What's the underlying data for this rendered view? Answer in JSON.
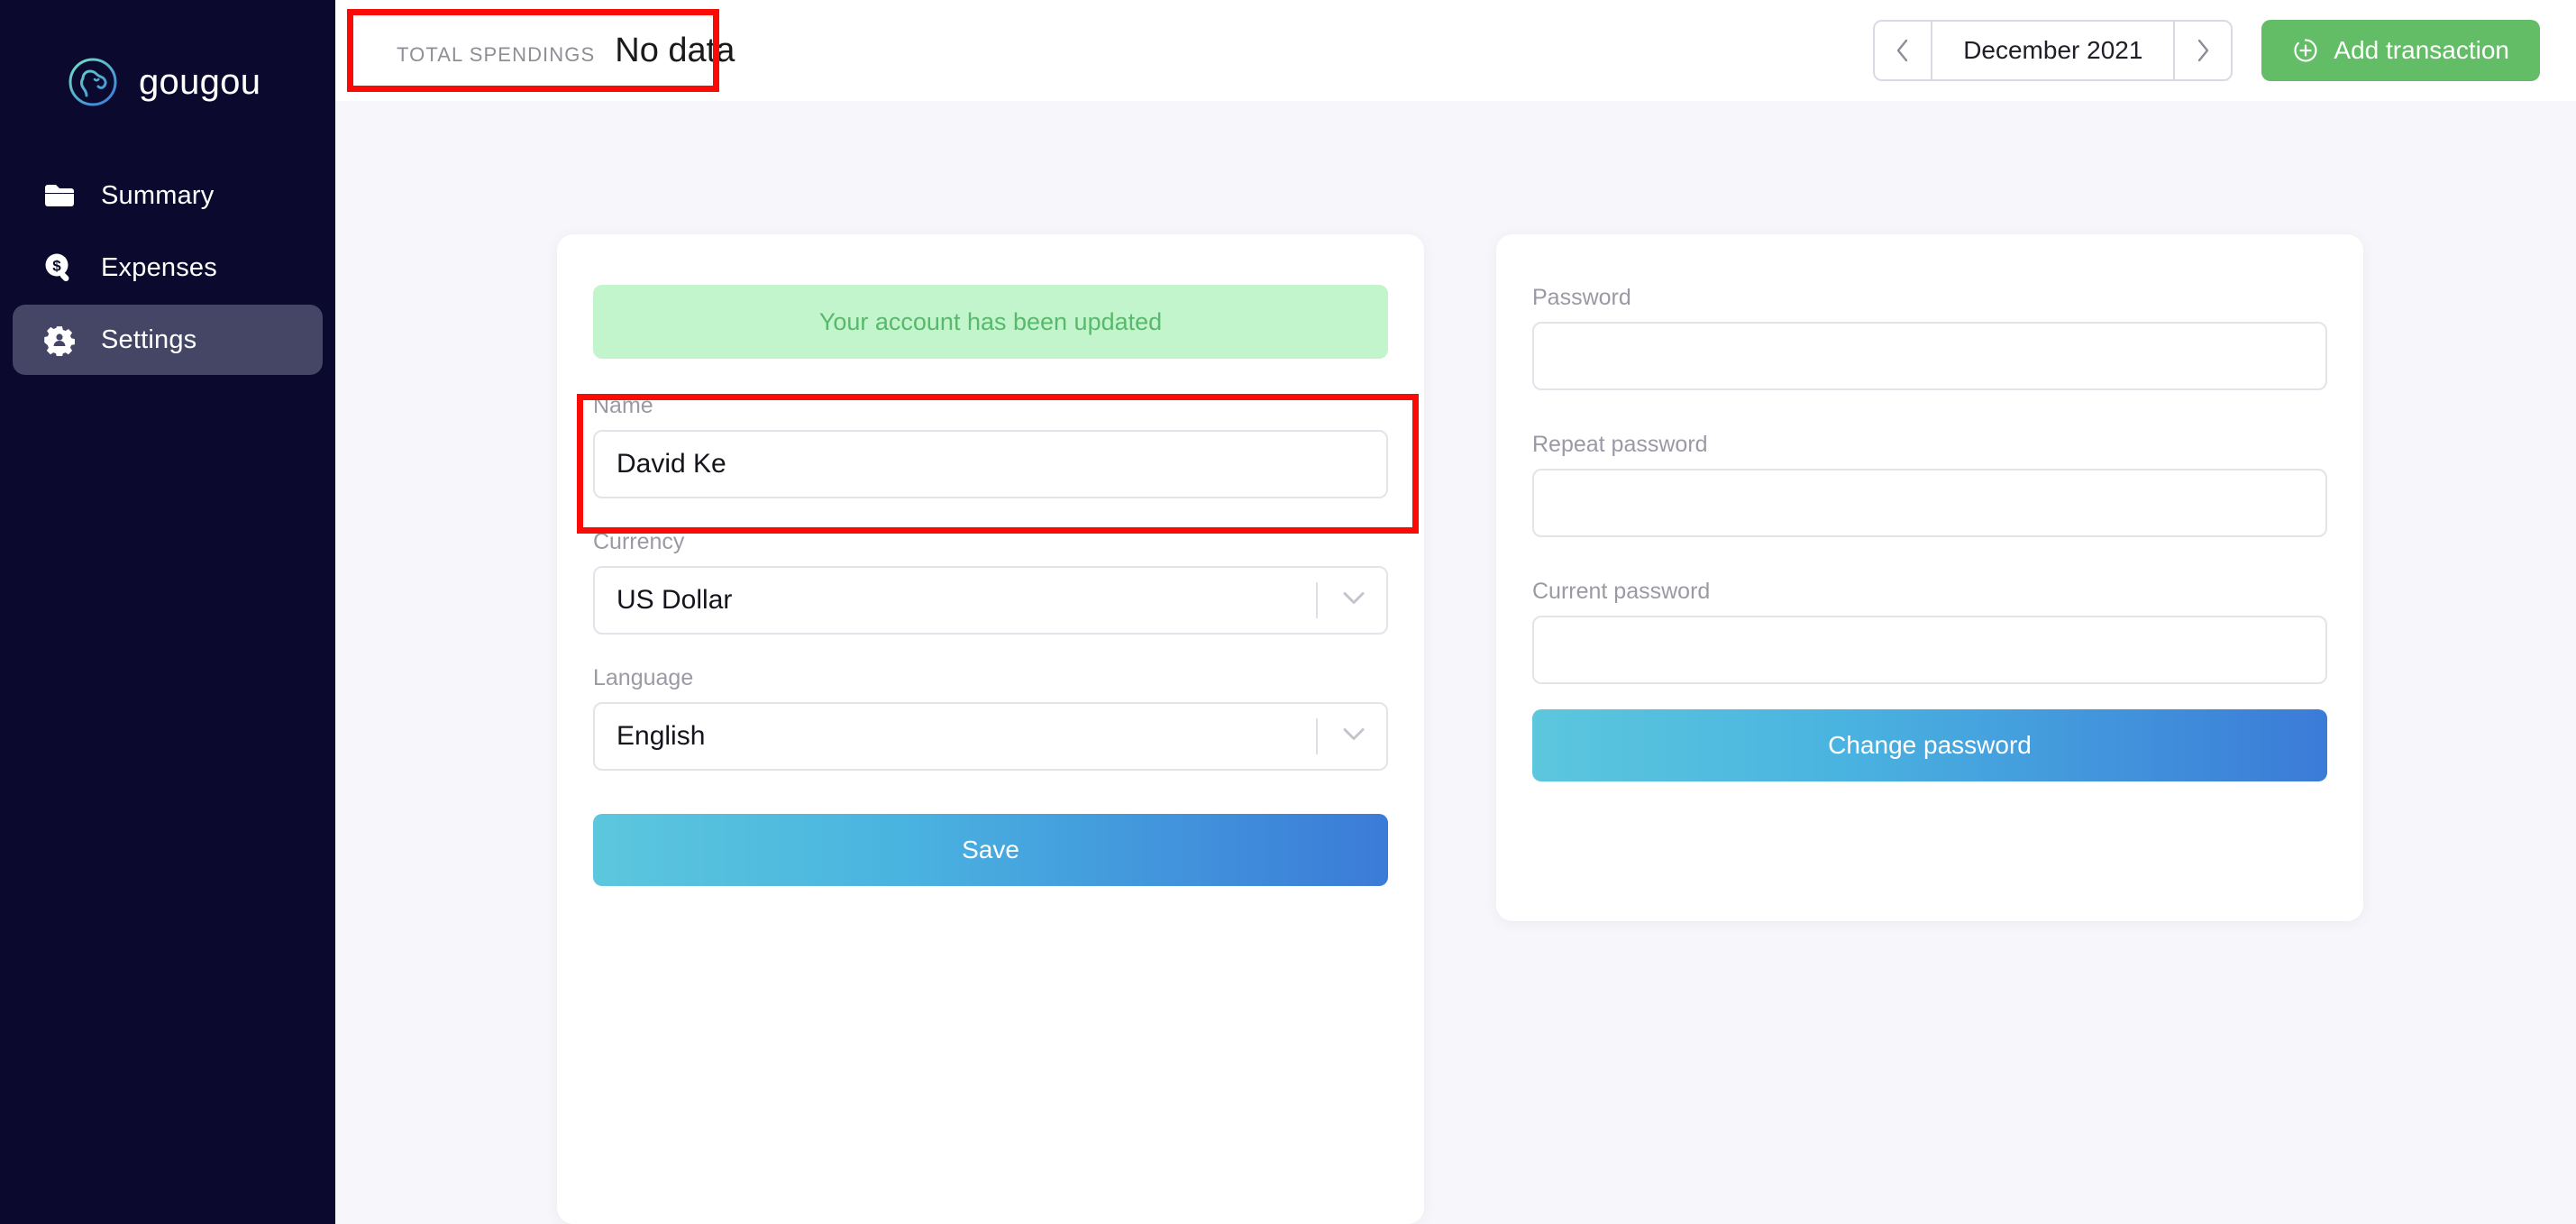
{
  "brand": {
    "name": "gougou",
    "logo_icon": "dog-circle-logo"
  },
  "sidebar": {
    "items": [
      {
        "label": "Summary",
        "icon": "folder-icon",
        "active": false
      },
      {
        "label": "Expenses",
        "icon": "dollar-search-icon",
        "active": false
      },
      {
        "label": "Settings",
        "icon": "gear-person-icon",
        "active": true
      }
    ]
  },
  "topbar": {
    "spendings_label": "TOTAL SPENDINGS",
    "spendings_value": "No data",
    "prev_icon": "chevron-left-icon",
    "next_icon": "chevron-right-icon",
    "date_label": "December 2021",
    "add_transaction_label": "Add transaction",
    "add_transaction_icon": "plus-circle-icon"
  },
  "account_card": {
    "alert": "Your account has been updated",
    "name_label": "Name",
    "name_value": "David Ke",
    "name_placeholder": "Name",
    "currency_label": "Currency",
    "currency_value": "US Dollar",
    "currency_icon": "chevron-down-icon",
    "language_label": "Language",
    "language_value": "English",
    "language_icon": "chevron-down-icon",
    "save_label": "Save"
  },
  "password_card": {
    "password_label": "Password",
    "password_value": "",
    "password_placeholder": "",
    "repeat_label": "Repeat password",
    "repeat_value": "",
    "repeat_placeholder": "",
    "current_label": "Current password",
    "current_value": "",
    "current_placeholder": "",
    "change_label": "Change password"
  },
  "colors": {
    "sidebar_bg": "#0b0a2e",
    "sidebar_active": "#454566",
    "page_bg": "#f7f7fb",
    "accent_green": "#63bd66",
    "alert_bg": "#c3f5cd",
    "alert_text": "#58b86c",
    "gradient_start": "#5cc7dd",
    "gradient_end": "#3b7bd8",
    "annotation_red": "#fb0b05"
  }
}
